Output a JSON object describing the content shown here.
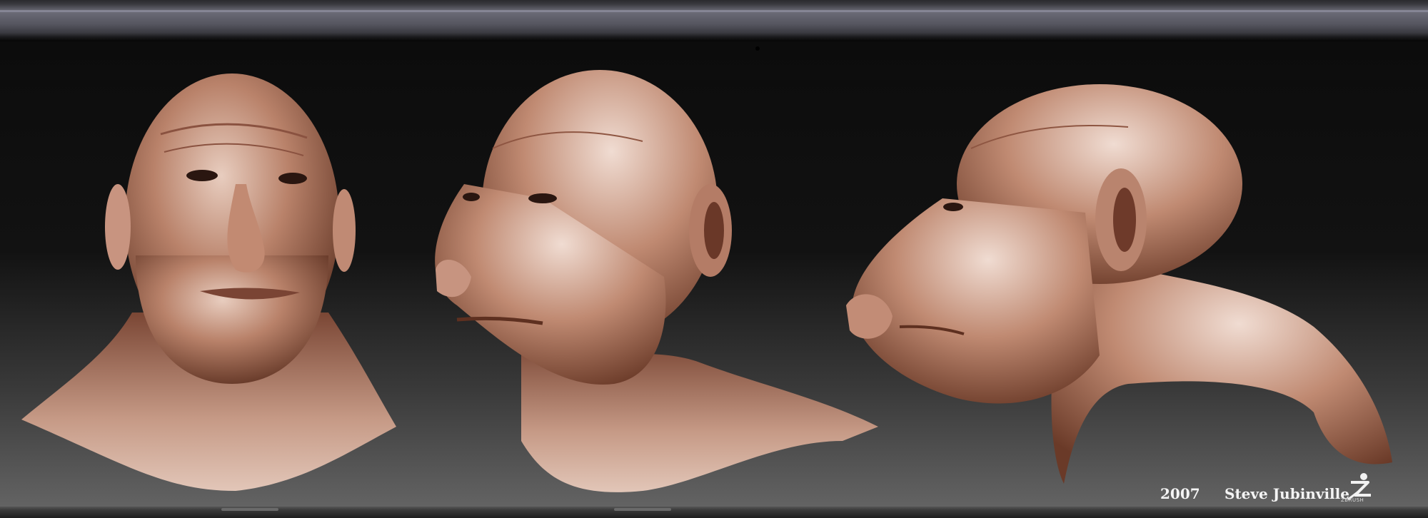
{
  "colors": {
    "skin": "#b07a62",
    "skin_light": "#e6c8ba",
    "skin_shadow": "#6a3b2a",
    "background_top": "#0c0c0c",
    "background_bottom": "#636363"
  },
  "caption": {
    "year": "2007",
    "artist": "Steve Jubinville"
  },
  "logo": {
    "icon": "zbrush-logo-icon",
    "text": "ZBRUSH"
  },
  "views": [
    {
      "name": "front-view"
    },
    {
      "name": "three-quarter-view"
    },
    {
      "name": "side-profile-view"
    }
  ]
}
